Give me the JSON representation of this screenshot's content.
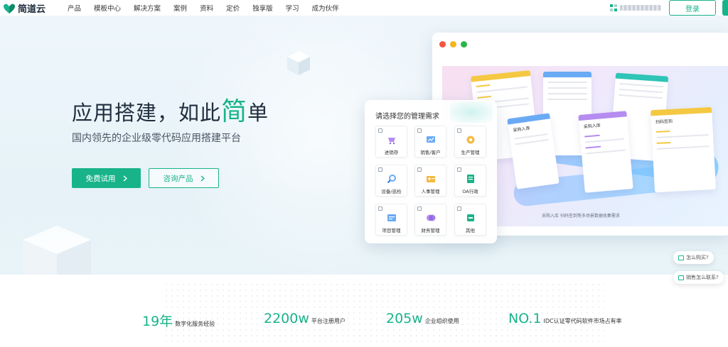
{
  "brand": {
    "name": "简道云",
    "accent": "#19b38a"
  },
  "nav": {
    "items": [
      "产品",
      "模板中心",
      "解决方案",
      "案例",
      "资料",
      "定价",
      "独享版",
      "学习",
      "成为伙伴"
    ]
  },
  "header": {
    "login_label": "登录"
  },
  "hero": {
    "headline_prefix": "应用搭建，如此",
    "headline_accent": "简",
    "headline_suffix": "单",
    "subhead": "国内领先的企业级零代码应用搭建平台",
    "primary_cta": "免费试用",
    "secondary_cta": "咨询产品"
  },
  "selector": {
    "title": "请选择您的管理需求",
    "options": [
      {
        "label": "进销存",
        "icon": "cart-icon"
      },
      {
        "label": "销售/客户",
        "icon": "sales-icon"
      },
      {
        "label": "生产管理",
        "icon": "production-icon"
      },
      {
        "label": "设备/巡检",
        "icon": "inspection-icon"
      },
      {
        "label": "人事管理",
        "icon": "hr-icon"
      },
      {
        "label": "OA行政",
        "icon": "oa-icon"
      },
      {
        "label": "项目管理",
        "icon": "project-icon"
      },
      {
        "label": "财务管理",
        "icon": "finance-icon"
      },
      {
        "label": "其他",
        "icon": "other-icon"
      }
    ]
  },
  "mockup": {
    "boards": [
      "采购入库",
      "采购入库",
      "扫码签到"
    ],
    "caption": "采购入库  扫码签到等多场景数据收集需求"
  },
  "chips": {
    "buy": "怎么购买?",
    "contact": "销售怎么联系?"
  },
  "stats": [
    {
      "value": "19年",
      "label": "数字化服务经验"
    },
    {
      "value": "2200w",
      "label": "平台注册用户"
    },
    {
      "value": "205w",
      "label": "企业组织使用"
    },
    {
      "value": "NO.1",
      "label": "IDC认证零代码软件市场占有率"
    }
  ]
}
